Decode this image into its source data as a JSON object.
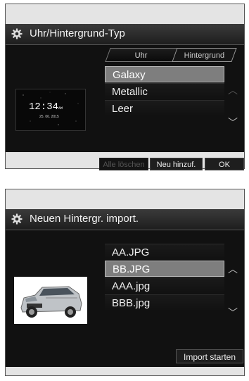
{
  "panel1": {
    "title": "Uhr/Hintergrund-Typ",
    "tabs": [
      "Uhr",
      "Hintergrund"
    ],
    "active_tab": "Hintergrund",
    "items": [
      "Galaxy",
      "Metallic",
      "Leer"
    ],
    "selected_item": "Galaxy",
    "preview": {
      "time": "12:34",
      "time_suffix": "AM",
      "date": "25. 06. 2015"
    },
    "buttons": {
      "delete": "Alle löschen",
      "new": "Neu hinzuf.",
      "ok": "OK"
    }
  },
  "panel2": {
    "title": "Neuen Hintergr. import.",
    "items": [
      "AA.JPG",
      "BB.JPG",
      "AAA.jpg",
      "BBB.jpg"
    ],
    "selected_item": "BB.JPG",
    "buttons": {
      "import": "Import starten"
    }
  },
  "icons": [
    "gear-icon",
    "chevron-up-icon",
    "chevron-down-icon"
  ]
}
